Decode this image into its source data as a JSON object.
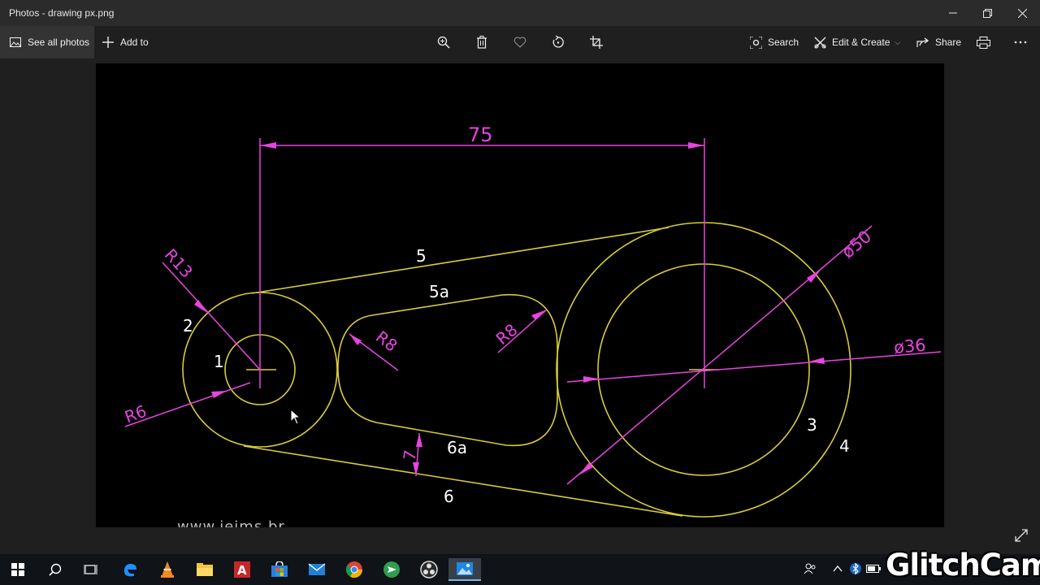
{
  "window": {
    "title": "Photos - drawing px.png",
    "controls": [
      "minimize-icon",
      "restore-icon",
      "close-icon"
    ]
  },
  "toolbar": {
    "see_all_label": "See all photos",
    "add_to_label": "Add to",
    "center_icons": [
      "zoom-in-icon",
      "delete-icon",
      "favorite-icon",
      "rotate-icon",
      "crop-icon"
    ],
    "search_label": "Search",
    "edit_create_label": "Edit & Create",
    "share_label": "Share",
    "print_icon": "print-icon",
    "more_icon": "more-icon"
  },
  "drawing": {
    "colors": {
      "geometry": "#d8cc3c",
      "dimension": "#e844e0",
      "background": "#000000",
      "text": "#ffffff"
    },
    "dimension_labels": [
      "75",
      "R13",
      "R6",
      "R8",
      "R8",
      "ø50",
      "ø36",
      "7"
    ],
    "part_labels": [
      "1",
      "2",
      "3",
      "4",
      "5",
      "5a",
      "6",
      "6a"
    ],
    "watermark": "www.ieims.br"
  },
  "taskbar": {
    "apps": [
      "start-icon",
      "search-icon",
      "task-view-icon",
      "edge-icon",
      "vlc-icon",
      "file-explorer-icon",
      "autocad-icon",
      "store-icon",
      "mail-icon",
      "chrome-icon",
      "app-green-icon",
      "obs-icon",
      "photos-icon"
    ],
    "tray": [
      "people-icon",
      "chevron-up-icon",
      "bluetooth-icon",
      "battery-icon"
    ]
  },
  "overlay": {
    "brand": "GlitchCam"
  }
}
